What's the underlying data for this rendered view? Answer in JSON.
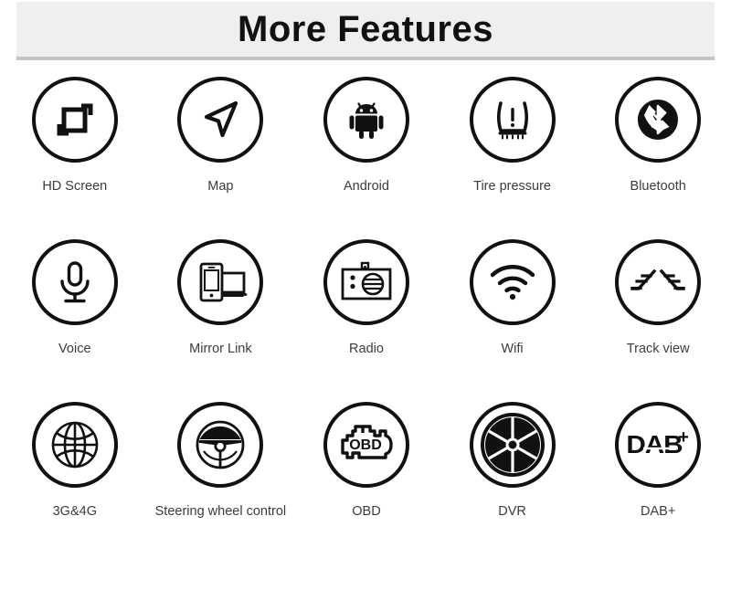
{
  "header": {
    "title": "More Features",
    "background": "#efefef",
    "border_color": "#c4c4c4",
    "title_color": "#111111"
  },
  "theme": {
    "page_background": "#ffffff",
    "icon_stroke": "#111111",
    "label_color": "#3c3c3c"
  },
  "features": {
    "rows": [
      [
        {
          "label": "HD Screen",
          "icon": "hd-screen-icon"
        },
        {
          "label": "Map",
          "icon": "navigation-arrow-icon"
        },
        {
          "label": "Android",
          "icon": "android-robot-icon"
        },
        {
          "label": "Tire pressure",
          "icon": "tire-pressure-warning-icon"
        },
        {
          "label": "Bluetooth",
          "icon": "bluetooth-phone-icon"
        }
      ],
      [
        {
          "label": "Voice",
          "icon": "microphone-icon"
        },
        {
          "label": "Mirror Link",
          "icon": "phone-screen-mirror-icon"
        },
        {
          "label": "Radio",
          "icon": "radio-icon"
        },
        {
          "label": "Wifi",
          "icon": "wifi-icon"
        },
        {
          "label": "Track view",
          "icon": "parking-track-lines-icon"
        }
      ],
      [
        {
          "label": "3G&4G",
          "icon": "globe-icon"
        },
        {
          "label": "Steering wheel control",
          "icon": "steering-wheel-icon"
        },
        {
          "label": "OBD",
          "icon": "obd-engine-icon"
        },
        {
          "label": "DVR",
          "icon": "camera-aperture-icon"
        },
        {
          "label": "DAB+",
          "icon": "dab-plus-logo-icon"
        }
      ]
    ]
  }
}
